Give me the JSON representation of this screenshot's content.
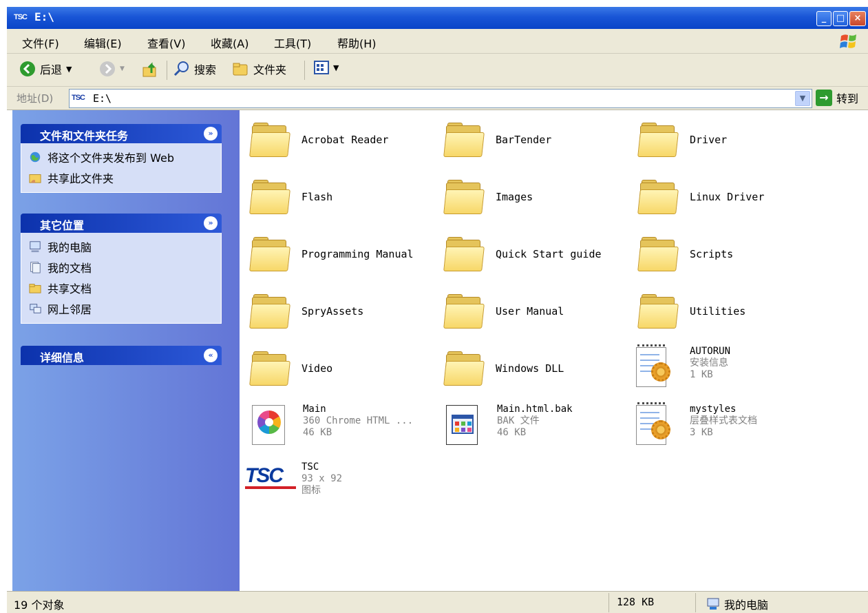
{
  "window": {
    "title": "E:\\",
    "app_icon_text": "TSC",
    "minimize": "_",
    "maximize": "□",
    "close": "×"
  },
  "menubar": {
    "items": [
      "文件(F)",
      "编辑(E)",
      "查看(V)",
      "收藏(A)",
      "工具(T)",
      "帮助(H)"
    ]
  },
  "toolbar": {
    "back_label": "后退",
    "search_label": "搜索",
    "folders_label": "文件夹"
  },
  "address": {
    "label": "地址(D)",
    "icon_text": "TSC",
    "value": "E:\\",
    "go_label": "转到"
  },
  "taskpane": {
    "panels": [
      {
        "title": "文件和文件夹任务",
        "items": [
          "将这个文件夹发布到 Web",
          "共享此文件夹"
        ]
      },
      {
        "title": "其它位置",
        "items": [
          "我的电脑",
          "我的文档",
          "共享文档",
          "网上邻居"
        ]
      },
      {
        "title": "详细信息",
        "items": []
      }
    ]
  },
  "files": [
    {
      "name": "Acrobat Reader",
      "type": "folder"
    },
    {
      "name": "BarTender",
      "type": "folder"
    },
    {
      "name": "Driver",
      "type": "folder"
    },
    {
      "name": "Flash",
      "type": "folder"
    },
    {
      "name": "Images",
      "type": "folder"
    },
    {
      "name": "Linux Driver",
      "type": "folder"
    },
    {
      "name": "Programming Manual",
      "type": "folder"
    },
    {
      "name": "Quick Start guide",
      "type": "folder"
    },
    {
      "name": "Scripts",
      "type": "folder"
    },
    {
      "name": "SpryAssets",
      "type": "folder"
    },
    {
      "name": "User Manual",
      "type": "folder"
    },
    {
      "name": "Utilities",
      "type": "folder"
    },
    {
      "name": "Video",
      "type": "folder"
    },
    {
      "name": "Windows DLL",
      "type": "folder"
    },
    {
      "name": "AUTORUN",
      "type": "inf",
      "desc": "安装信息",
      "size": "1 KB"
    },
    {
      "name": "Main",
      "type": "html",
      "desc": "360 Chrome HTML ...",
      "size": "46 KB"
    },
    {
      "name": "Main.html.bak",
      "type": "bak",
      "desc": "BAK 文件",
      "size": "46 KB"
    },
    {
      "name": "mystyles",
      "type": "css",
      "desc": "层叠样式表文档",
      "size": "3 KB"
    },
    {
      "name": "TSC",
      "type": "icon",
      "desc": "93 x 92",
      "size": "图标"
    }
  ],
  "statusbar": {
    "count": "19 个对象",
    "size": "128 KB",
    "location": "我的电脑"
  },
  "colors": {
    "title_bar": "#1955d6",
    "task_pane": "#6f8fe0",
    "chrome": "#ece9d8"
  }
}
